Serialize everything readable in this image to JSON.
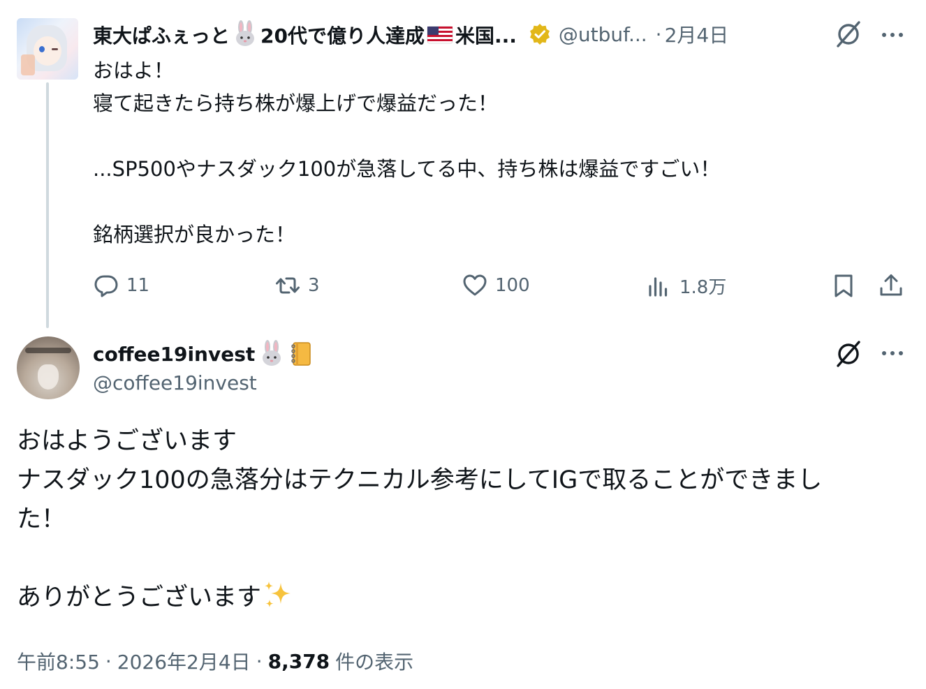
{
  "parent_post": {
    "display_name_part1": "東大ぱふぇっと",
    "display_name_part2": "20代で億り人達成",
    "display_name_part3": "米国...",
    "verified_badge": "gold-verified-icon",
    "handle": "@utbuf...",
    "separator": "·",
    "date": "2月4日",
    "text": "おはよ！\n寝て起きたら持ち株が爆上げで爆益だった！\n\n...SP500やナスダック100が急落してる中、持ち株は爆益ですごい！\n\n銘柄選択が良かった！",
    "actions": {
      "reply_count": "11",
      "repost_count": "3",
      "like_count": "100",
      "views_count": "1.8万"
    }
  },
  "reply_post": {
    "display_name": "coffee19invest",
    "handle": "@coffee19invest",
    "text_main": "おはようございます\nナスダック100の急落分はテクニカル参考にしてIGで取ることができまし\nた！\n\nありがとうございます",
    "meta": {
      "time": "午前8:55",
      "separator": "·",
      "date": "2026年2月4日",
      "separator2": "·",
      "views": "8,378",
      "views_label": "件の表示"
    }
  },
  "colors": {
    "text_primary": "#0f1419",
    "text_secondary": "#536471",
    "thread_line": "#cfd9de",
    "verified_gold": "#e2b719"
  },
  "icons": [
    "grok-icon",
    "more-icon",
    "reply-icon",
    "repost-icon",
    "like-icon",
    "views-icon",
    "bookmark-icon",
    "share-icon",
    "rabbit-emoji",
    "us-flag-emoji",
    "notebook-emoji",
    "sparkles-emoji"
  ]
}
